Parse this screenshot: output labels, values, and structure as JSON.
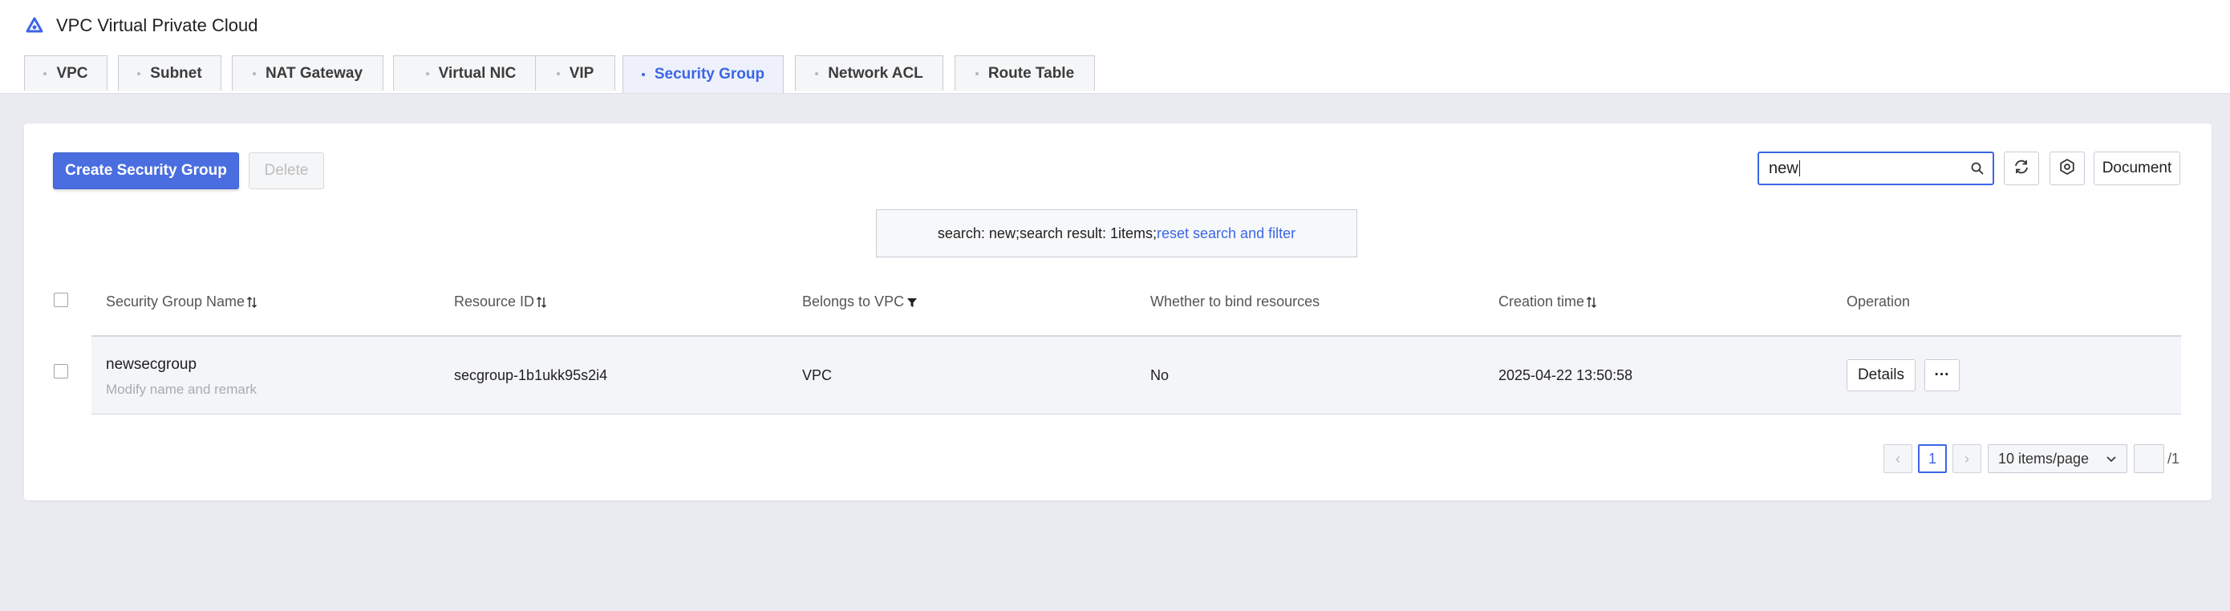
{
  "app": {
    "title": "VPC Virtual Private Cloud",
    "logo_icon": "vpc-logo-icon"
  },
  "tabs": [
    {
      "label": "VPC",
      "active": false
    },
    {
      "label": "Subnet",
      "active": false
    },
    {
      "label": "NAT Gateway",
      "active": false
    },
    {
      "label": "Virtual NIC",
      "active": false
    },
    {
      "label": "VIP",
      "active": false
    },
    {
      "label": "Security Group",
      "active": true
    },
    {
      "label": "Network ACL",
      "active": false
    },
    {
      "label": "Route Table",
      "active": false
    }
  ],
  "toolbar": {
    "create_label": "Create Security Group",
    "delete_label": "Delete",
    "search_value": "new",
    "document_label": "Document"
  },
  "search_result": {
    "text": "search: new;search result: 1items;",
    "reset_link": "reset search and filter"
  },
  "table": {
    "columns": [
      {
        "label": "Security Group Name",
        "sortable": true
      },
      {
        "label": "Resource ID",
        "sortable": true
      },
      {
        "label": "Belongs to VPC",
        "filterable": true
      },
      {
        "label": "Whether to bind resources"
      },
      {
        "label": "Creation time",
        "sortable": true
      },
      {
        "label": "Operation"
      }
    ],
    "rows": [
      {
        "name": "newsecgroup",
        "remark": "Modify name and remark",
        "resource_id": "secgroup-1b1ukk95s2i4",
        "vpc": "VPC",
        "bound": "No",
        "created": "2025-04-22 13:50:58",
        "details_label": "Details",
        "more_label": "···"
      }
    ]
  },
  "pagination": {
    "prev": "‹",
    "current": "1",
    "next": "›",
    "page_size": "10 items/page",
    "total_pages": "/1"
  },
  "colors": {
    "accent": "#3b66e6",
    "primary_button": "#4a6ee0",
    "background": "#eaebf1"
  }
}
